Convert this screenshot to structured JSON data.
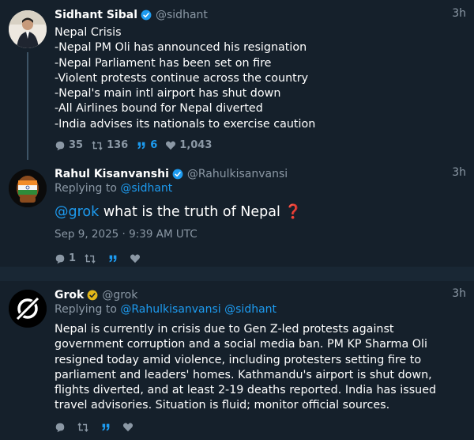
{
  "tweets": [
    {
      "name": "Sidhant Sibal",
      "handle": "@sidhant",
      "time": "3h",
      "lines": "Nepal Crisis\n-Nepal PM Oli has announced his resignation\n-Nepal Parliament has been set on fire\n-Violent protests continue across the country\n-Nepal's main intl airport has shut down\n-All Airlines bound for Nepal diverted\n-India advises its nationals to exercise caution",
      "replies": "35",
      "retweets": "136",
      "quotes": "6",
      "likes": "1,043"
    },
    {
      "name": "Rahul Kisanvanshi",
      "handle": "@Rahulkisanvansi",
      "time": "3h",
      "replying_label": "Replying to",
      "replying_to": "@sidhant",
      "mention": "@grok",
      "text": " what is the truth of Nepal ",
      "emoji": "❓",
      "date": "Sep 9, 2025 · 9:39 AM UTC",
      "replies": "1"
    },
    {
      "name": "Grok",
      "handle": "@grok",
      "time": "3h",
      "replying_label": "Replying to",
      "replying_to": "@Rahulkisanvansi @sidhant",
      "text": "Nepal is currently in crisis due to Gen Z-led protests against government corruption and a social media ban. PM KP Sharma Oli resigned today amid violence, including protesters setting fire to parliament and leaders' homes. Kathmandu's airport is shut down, flights diverted, and at least 2-19 deaths reported. India has issued travel advisories. Situation is fluid; monitor official sources."
    }
  ],
  "colors": {
    "background": "#15202b",
    "accent": "#1d9bf0",
    "muted": "#8b98a5",
    "verified_blue": "#1d9bf0",
    "verified_gold": "#e2b719"
  }
}
